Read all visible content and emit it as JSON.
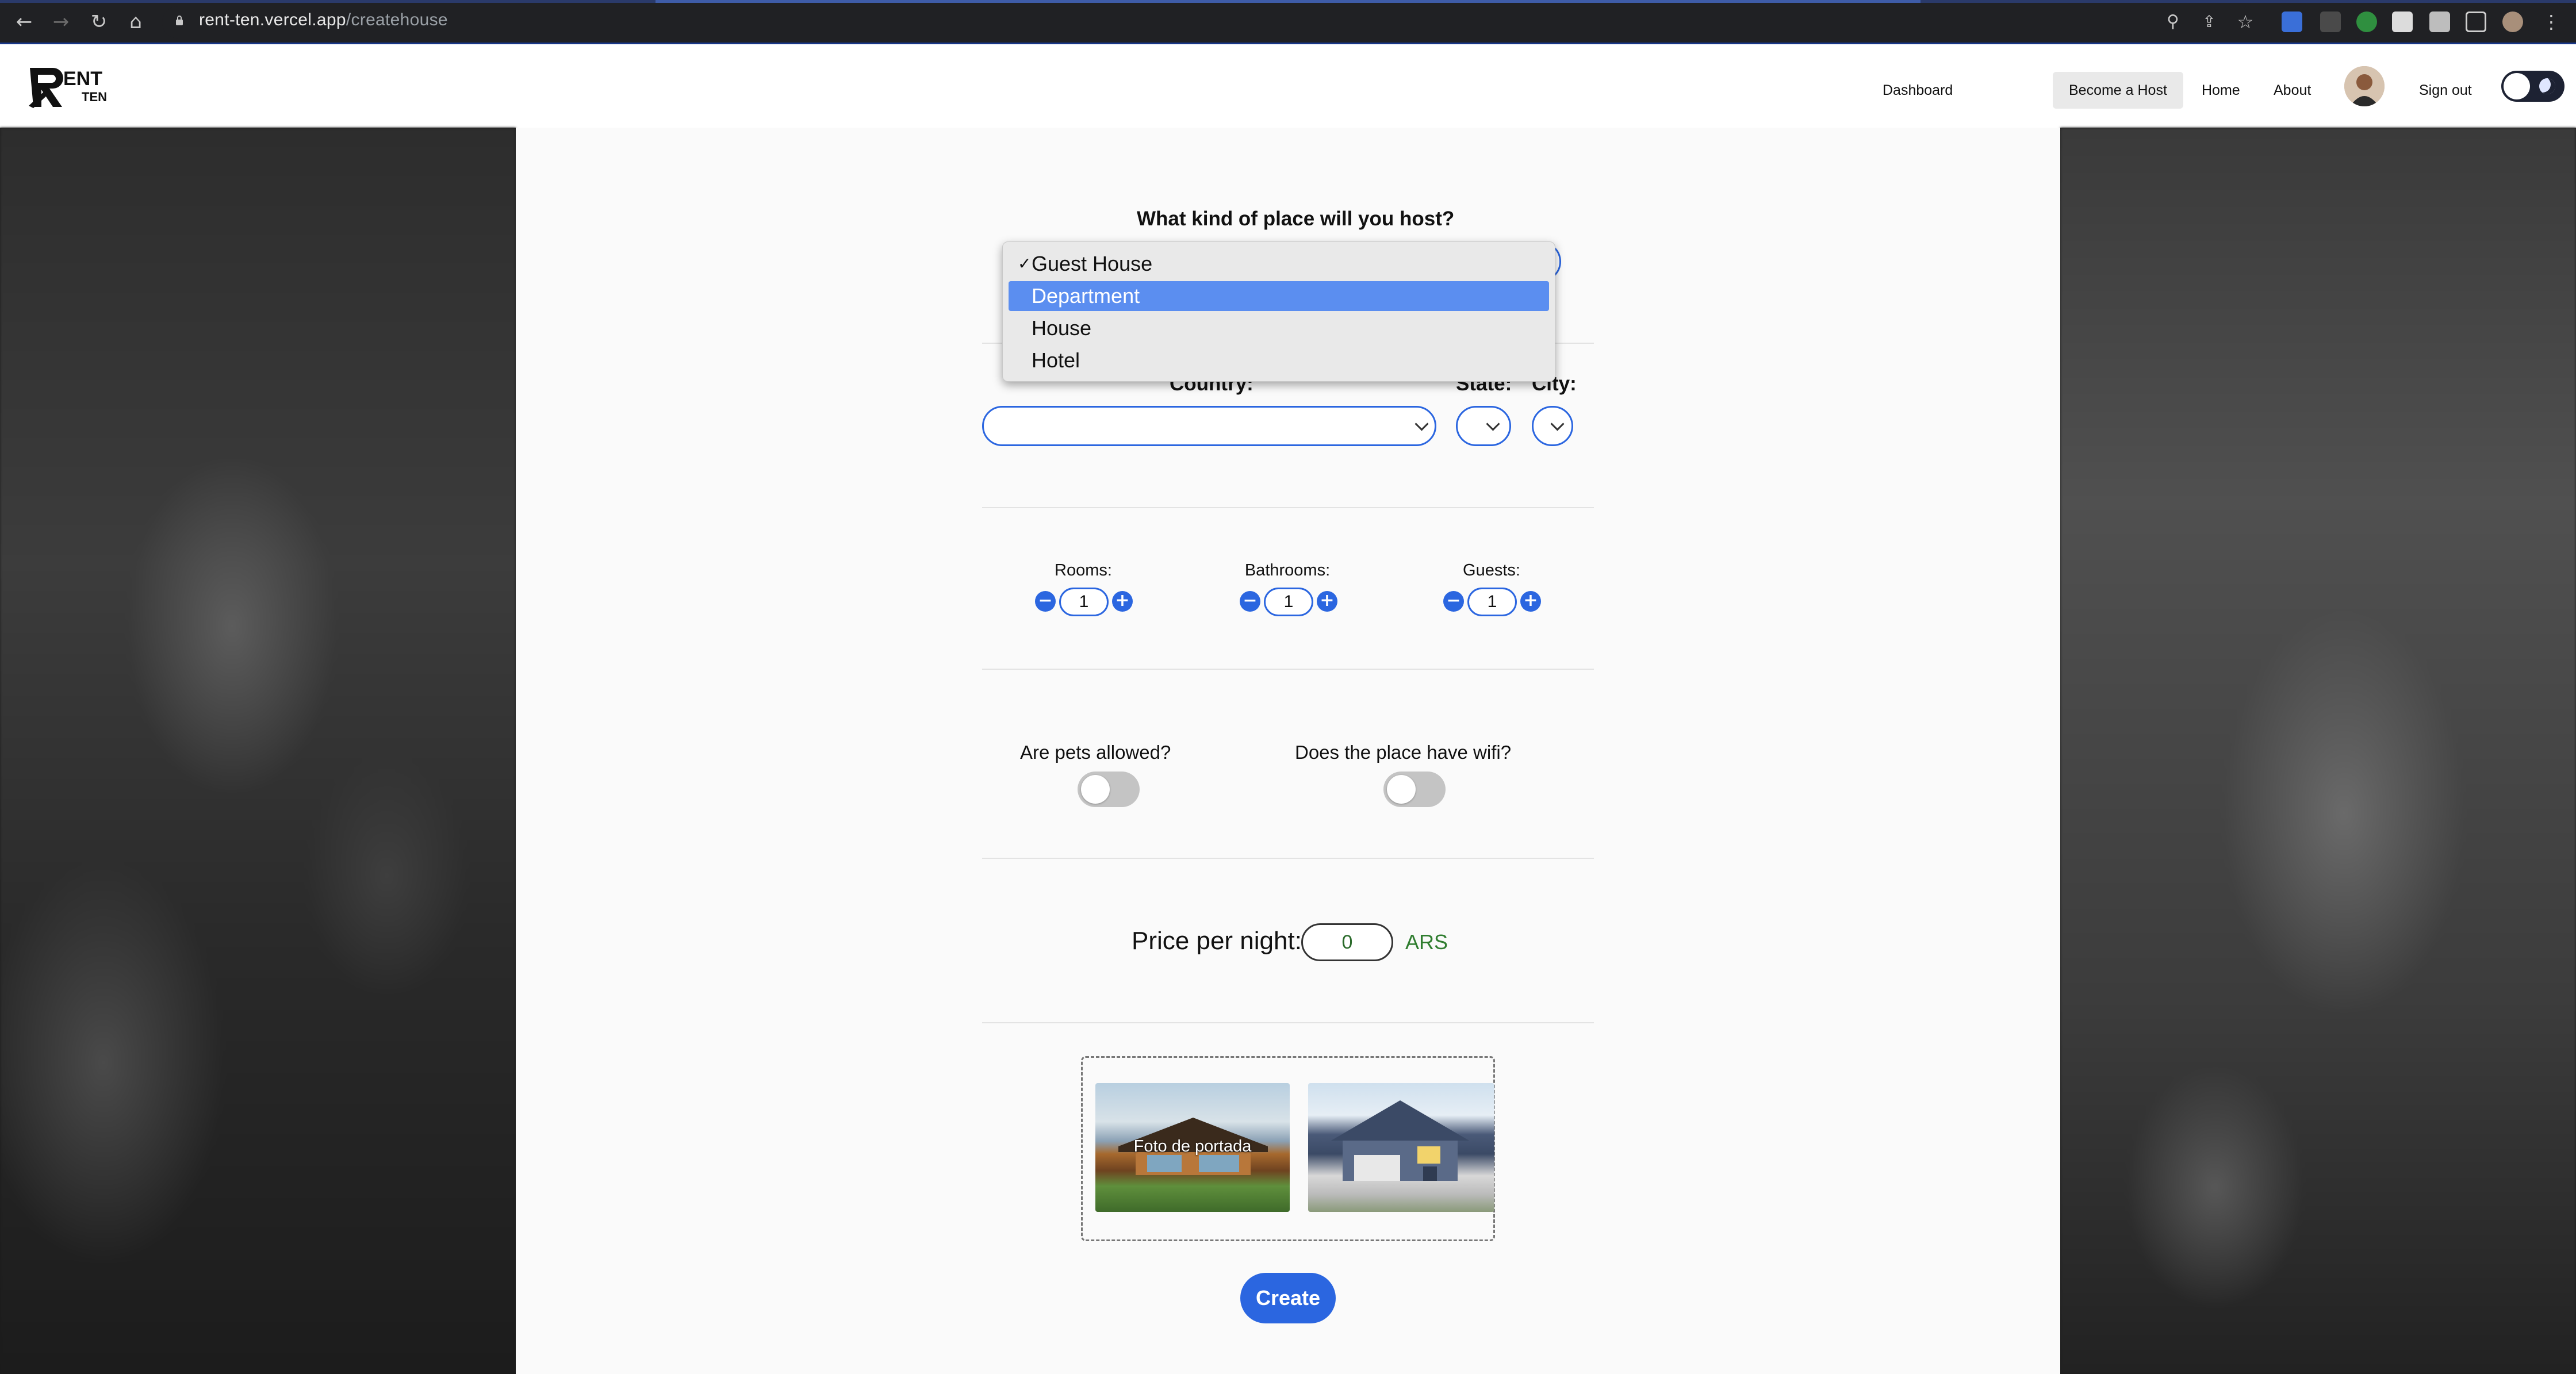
{
  "browser": {
    "url_host": "rent-ten.vercel.app",
    "url_path": "/createhouse"
  },
  "header": {
    "logo_text": "RENT TEN",
    "nav": {
      "dashboard": "Dashboard",
      "become_host": "Become a Host",
      "home": "Home",
      "about": "About",
      "sign_out": "Sign out"
    }
  },
  "form": {
    "place_type": {
      "question": "What kind of place will you host?",
      "options": [
        "Guest House",
        "Department",
        "House",
        "Hotel"
      ],
      "checked": "Guest House",
      "highlighted": "Department",
      "check_mark": "✓"
    },
    "location": {
      "country_label": "Country:",
      "state_label": "State:",
      "city_label": "City:"
    },
    "counters": {
      "rooms_label": "Rooms:",
      "rooms_value": "1",
      "bathrooms_label": "Bathrooms:",
      "bathrooms_value": "1",
      "guests_label": "Guests:",
      "guests_value": "1",
      "minus": "−",
      "plus": "+"
    },
    "toggles": {
      "pets_question": "Are pets allowed?",
      "pets_on": false,
      "wifi_question": "Does the place have wifi?",
      "wifi_on": false
    },
    "price": {
      "label": "Price per night:",
      "value": "0",
      "currency": "ARS"
    },
    "photos": {
      "cover_caption": "Foto de portada"
    },
    "create_label": "Create"
  },
  "colors": {
    "accent": "#2b66e0",
    "highlight": "#5b8ef0",
    "currency": "#2f7d2f"
  }
}
